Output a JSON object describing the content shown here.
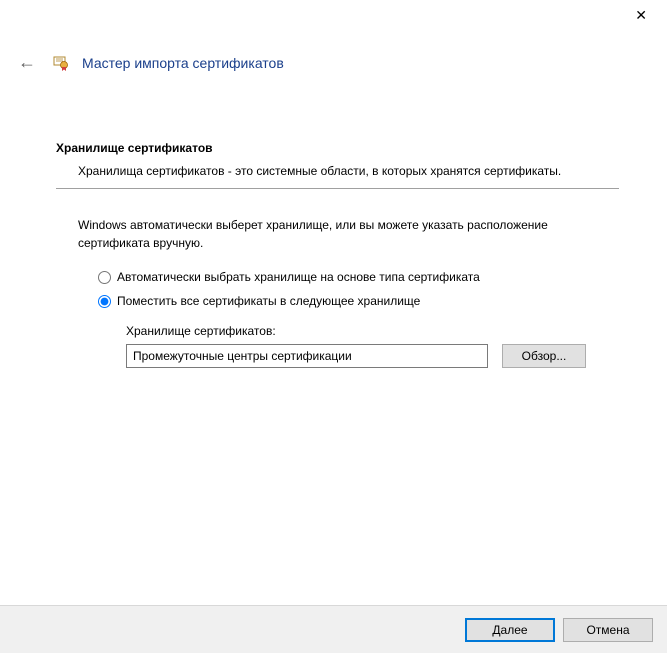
{
  "window": {
    "title": "Мастер импорта сертификатов"
  },
  "section": {
    "heading": "Хранилище сертификатов",
    "description": "Хранилища сертификатов - это системные области, в которых хранятся сертификаты."
  },
  "instruction": "Windows автоматически выберет хранилище, или вы можете указать расположение сертификата вручную.",
  "radios": {
    "auto": "Автоматически выбрать хранилище на основе типа сертификата",
    "place": "Поместить все сертификаты в следующее хранилище",
    "selected": "place"
  },
  "store": {
    "label": "Хранилище сертификатов:",
    "value": "Промежуточные центры сертификации",
    "browse": "Обзор..."
  },
  "footer": {
    "next": "Далее",
    "cancel": "Отмена"
  }
}
